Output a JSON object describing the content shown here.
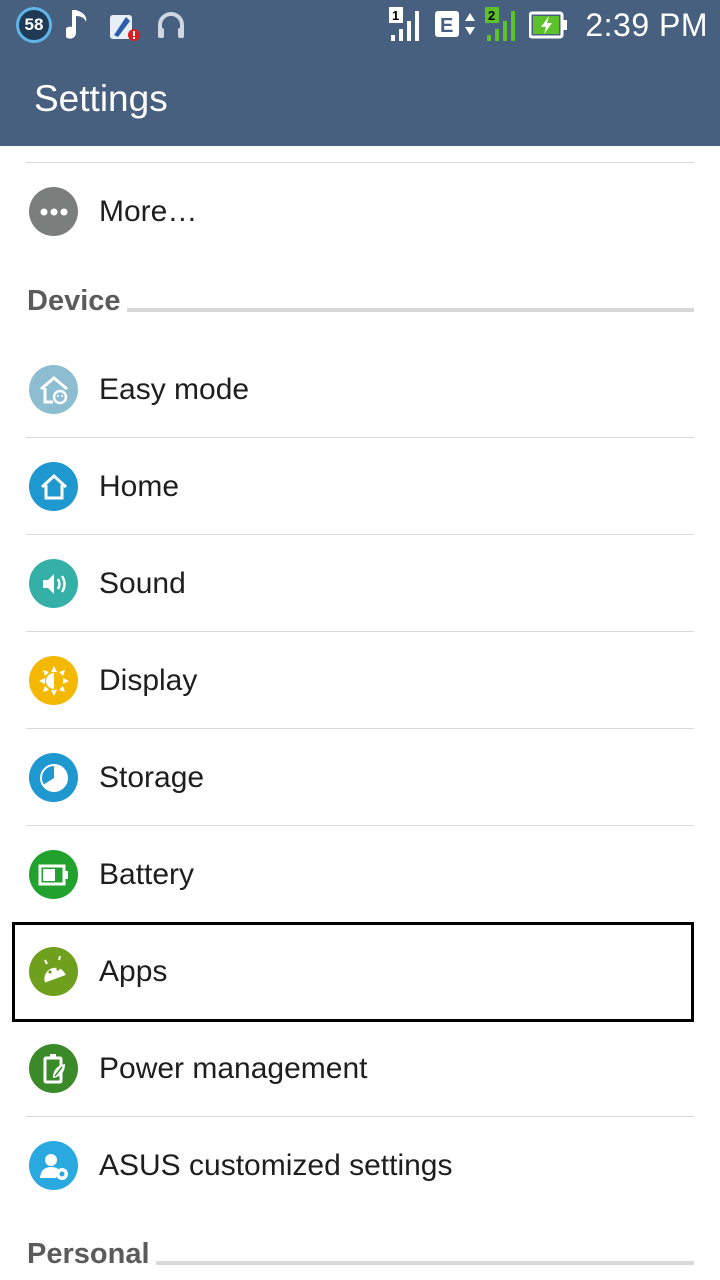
{
  "statusbar": {
    "notification_count": "58",
    "sim1_label": "1",
    "sim2_label": "2",
    "network_type": "E",
    "time": "2:39 PM",
    "icons": [
      "notification-badge-icon",
      "music-note-icon",
      "app-update-alert-icon",
      "headset-icon",
      "sim1-signal-icon",
      "data-edge-icon",
      "sim2-signal-icon",
      "battery-charging-icon"
    ]
  },
  "toolbar": {
    "title": "Settings"
  },
  "list": {
    "more_label": "More…",
    "device_header": "Device",
    "items": [
      {
        "label": "Easy mode",
        "icon": "easy-mode-icon",
        "color": "#8dbdd0"
      },
      {
        "label": "Home",
        "icon": "home-icon",
        "color": "#1f97cf"
      },
      {
        "label": "Sound",
        "icon": "sound-icon",
        "color": "#35b0a6"
      },
      {
        "label": "Display",
        "icon": "display-brightness-icon",
        "color": "#f5b800"
      },
      {
        "label": "Storage",
        "icon": "storage-icon",
        "color": "#1f97cf"
      },
      {
        "label": "Battery",
        "icon": "battery-icon",
        "color": "#22a12f"
      },
      {
        "label": "Apps",
        "icon": "android-apps-icon",
        "color": "#6fa01d"
      },
      {
        "label": "Power management",
        "icon": "power-management-icon",
        "color": "#3b8a2a"
      },
      {
        "label": "ASUS customized settings",
        "icon": "asus-customized-icon",
        "color": "#2aa8e0"
      }
    ],
    "personal_header": "Personal"
  },
  "colors": {
    "topbar": "#47607f",
    "more_icon": "#7a7e7c",
    "text": "#1e1e1e",
    "section_text": "#5b5b5b"
  }
}
